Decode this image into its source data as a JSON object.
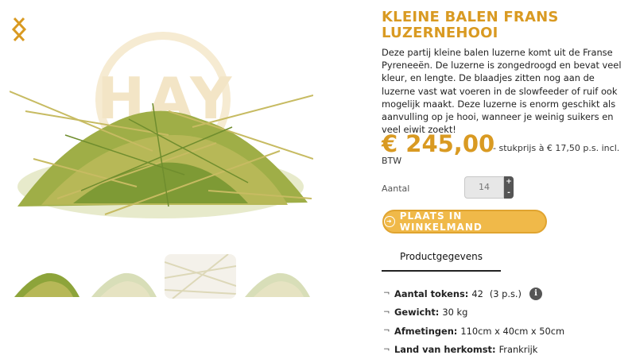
{
  "product": {
    "title": "KLEINE BALEN FRANS LUZERNEHOOI",
    "description": "Deze partij kleine balen luzerne komt uit de Franse Pyreneeën. De luzerne is zongedroogd en bevat veel kleur, en lengte. De blaadjes zitten nog aan de luzerne vast wat voeren in de slowfeeder of ruif ook mogelijk maakt. Deze luzerne is enorm geschikt als aanvulling op je hooi, wanneer je weinig suikers en veel eiwit zoekt!",
    "price": "€ 245,00",
    "unit_price": "- stukprijs à € 17,50 p.s. incl.",
    "vat": "BTW"
  },
  "gallery": {
    "watermark": "HAY",
    "prev_icon": "chevron-left-icon",
    "next_icon": "chevron-right-icon",
    "thumbnail_count": 4
  },
  "quantity": {
    "label": "Aantal",
    "value": "14",
    "plus": "+",
    "minus": "-"
  },
  "cart": {
    "button_label": "PLAATS IN WINKELMAND",
    "icon": "arrow-circle-icon"
  },
  "tabs": {
    "product_details": "Productgegevens"
  },
  "specs": [
    {
      "label": "Aantal tokens:",
      "value": "42",
      "extra": "(3 p.s.)"
    },
    {
      "label": "Gewicht:",
      "value": "30 kg"
    },
    {
      "label": "Afmetingen:",
      "value": "110cm x 40cm x 50cm"
    },
    {
      "label": "Land van herkomst:",
      "value": "Frankrijk"
    }
  ],
  "spec_bullet": "¬",
  "colors": {
    "accent": "#d99a22",
    "button": "#f0b949",
    "hay_green": "#8da43a",
    "hay_yellow": "#c9b457"
  }
}
